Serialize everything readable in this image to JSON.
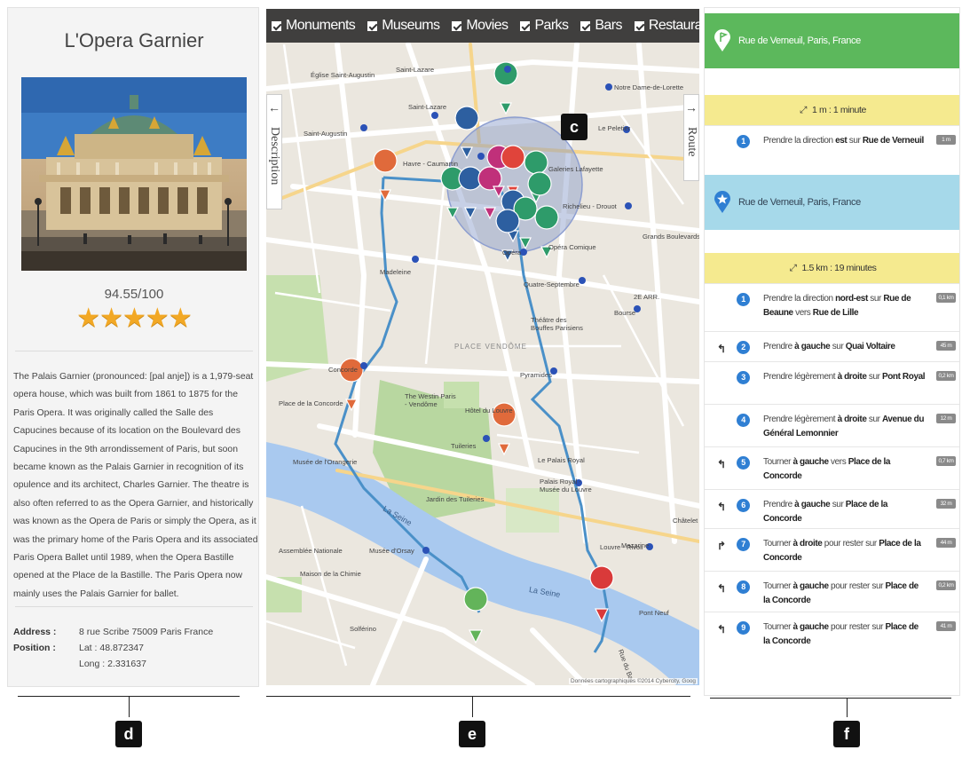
{
  "left": {
    "title": "L'Opera Garnier",
    "score": "94.55/100",
    "stars": "★★★★★",
    "description": "The Palais Garnier (pronounced: [pal anje]) is a 1,979-seat opera house, which was built from 1861 to 1875 for the Paris Opera. It was originally called the Salle des Capucines because of its location on the Boulevard des Capucines in the 9th arrondissement of Paris, but soon became known as the Palais Garnier in recognition of its opulence and its architect, Charles Garnier. The theatre is also often referred to as the Opera Garnier, and historically was known as the Opera de Paris or simply the Opera, as it was the primary home of the Paris Opera and its associated Paris Opera Ballet until 1989, when the Opera Bastille opened at the Place de la Bastille. The Paris Opera now mainly uses the Palais Garnier for ballet.",
    "address_label": "Address :",
    "address_value": "8 rue Scribe 75009 Paris France",
    "position_label": "Position :",
    "lat": "Lat : 48.872347",
    "long": "Long : 2.331637"
  },
  "map": {
    "filters": [
      "Monuments",
      "Museums",
      "Movies",
      "Parks",
      "Bars",
      "Restaurants"
    ],
    "description_tab": "Description",
    "route_tab": "Route",
    "labels": {
      "l1": "Saint-Lazare",
      "l2": "Église Saint-Augustin",
      "l3": "Saint-Lazare",
      "l4": "Saint-Augustin",
      "l5": "Havre - Caumartin",
      "l6": "Notre Dame-de-Lorette",
      "l7": "Le Peletier",
      "l8": "Galeries Lafayette",
      "l9": "Richelieu - Drouot",
      "l10": "Grands Boulevards",
      "l11": "Madeleine",
      "l12": "Opéra",
      "l13": "Opéra Comique",
      "l14": "Quatre-Septembre",
      "l15": "2E ARR.",
      "l16": "Bourse",
      "l17": "Théâtre des Bouffes Parisiens",
      "l18": "PLACE VENDÔME",
      "l19": "Concorde",
      "l20": "Place de la Concorde",
      "l21": "The Westin Paris - Vendôme",
      "l22": "Hôtel du Louvre",
      "l23": "Pyramides",
      "l24": "Tuileries",
      "l25": "Jardin des Tuileries",
      "l26": "Musée de l'Orangerie",
      "l27": "Le Palais Royal",
      "l28": "Palais Royal - Musée du Louvre",
      "l29": "La Seine",
      "l30": "Louvre - Rivoli",
      "l31": "Châtelet",
      "l32": "Assemblée Nationale",
      "l33": "Musée d'Orsay",
      "l34": "Solférino",
      "l35": "Pont Neuf",
      "l36": "La Seine",
      "l37": "Rue du Bac",
      "l38": "Mazarine",
      "l39": "Maison de la Chimie"
    },
    "attribution": "Données cartographiques ©2014 Cybercity, Goog"
  },
  "route": {
    "from": "Rue de Verneuil, Paris, France",
    "leg1": "1 m : 1 minute",
    "step_a": {
      "num": "1",
      "pre": "Prendre la direction ",
      "dir": "est",
      "mid": " sur ",
      "street": "Rue de Verneuil",
      "dist": "1 m"
    },
    "to": "Rue de Verneuil, Paris, France",
    "leg2": "1.5 km : 19 minutes",
    "steps": [
      {
        "turn": "",
        "num": "1",
        "pre": "Prendre la direction ",
        "b1": "nord-est",
        "mid": " sur ",
        "b2": "Rue de Beaune",
        "mid2": " vers ",
        "b3": "Rue de Lille",
        "dist": "0,1 km"
      },
      {
        "turn": "↰",
        "num": "2",
        "pre": "Prendre ",
        "b1": "à gauche",
        "mid": " sur ",
        "b2": "Quai Voltaire",
        "mid2": "",
        "b3": "",
        "dist": "45 m"
      },
      {
        "turn": "",
        "num": "3",
        "pre": "Prendre légèrement ",
        "b1": "à droite",
        "mid": " sur ",
        "b2": "Pont Royal",
        "mid2": "",
        "b3": "",
        "dist": "0,2 km"
      },
      {
        "turn": "",
        "num": "4",
        "pre": "Prendre légèrement ",
        "b1": "à droite",
        "mid": " sur ",
        "b2": "Avenue du Général Lemonnier",
        "mid2": "",
        "b3": "",
        "dist": "12 m"
      },
      {
        "turn": "↰",
        "num": "5",
        "pre": "Tourner ",
        "b1": "à gauche",
        "mid": " vers ",
        "b2": "Place de la Concorde",
        "mid2": "",
        "b3": "",
        "dist": "0,7 km"
      },
      {
        "turn": "↰",
        "num": "6",
        "pre": "Prendre ",
        "b1": "à gauche",
        "mid": " sur ",
        "b2": "Place de la Concorde",
        "mid2": "",
        "b3": "",
        "dist": "32 m"
      },
      {
        "turn": "↱",
        "num": "7",
        "pre": "Tourner ",
        "b1": "à droite",
        "mid": " pour rester sur ",
        "b2": "Place de la Concorde",
        "mid2": "",
        "b3": "",
        "dist": "44 m"
      },
      {
        "turn": "↰",
        "num": "8",
        "pre": "Tourner ",
        "b1": "à gauche",
        "mid": " pour rester sur ",
        "b2": "Place de la Concorde",
        "mid2": "",
        "b3": "",
        "dist": "0,2 km"
      },
      {
        "turn": "↰",
        "num": "9",
        "pre": "Tourner ",
        "b1": "à gauche",
        "mid": " pour rester sur ",
        "b2": "Place de la Concorde",
        "mid2": "",
        "b3": "",
        "dist": "41 m"
      }
    ]
  },
  "callouts": {
    "c": "c",
    "d": "d",
    "e": "e",
    "f": "f"
  },
  "colors": {
    "green": "#5cb85c",
    "blue": "#a6d9ea",
    "yellow": "#f5ea8f",
    "route": "#4a90c8",
    "star": "#f2a825"
  }
}
